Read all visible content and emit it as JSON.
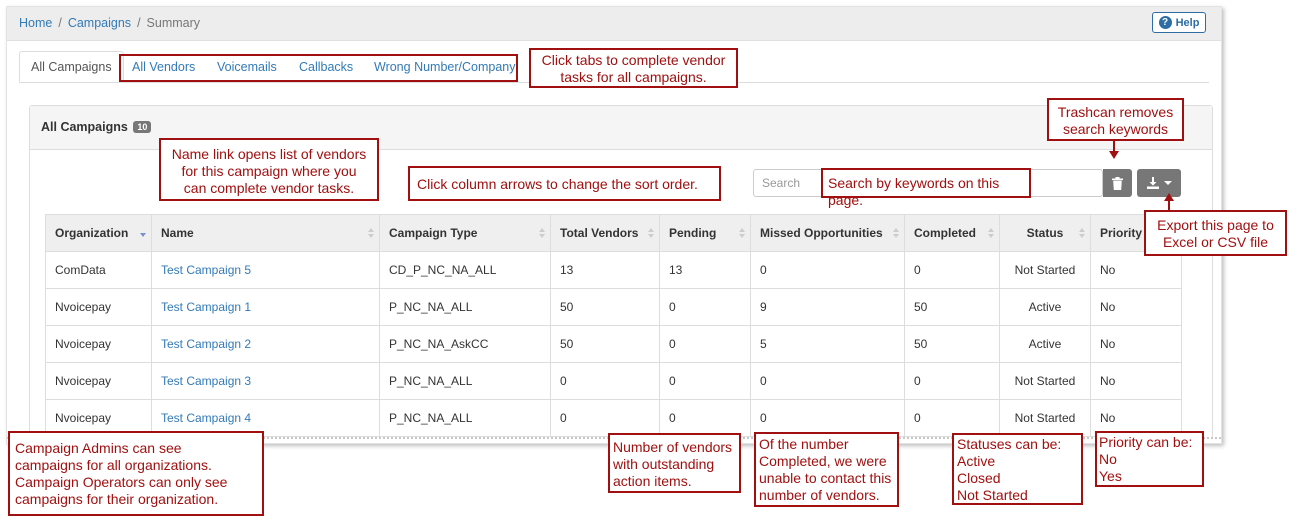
{
  "breadcrumb": {
    "home": "Home",
    "campaigns": "Campaigns",
    "current": "Summary",
    "sep": "/"
  },
  "help": {
    "label": "Help",
    "icon": "question-circle-icon"
  },
  "tabs": [
    {
      "label": "All Campaigns",
      "active": true
    },
    {
      "label": "All Vendors"
    },
    {
      "label": "Voicemails"
    },
    {
      "label": "Callbacks"
    },
    {
      "label": "Wrong Number/Company"
    }
  ],
  "panel": {
    "title": "All Campaigns",
    "count": "10"
  },
  "search": {
    "placeholder": "Search",
    "trash_icon": "trash-icon",
    "export_icon": "download-icon"
  },
  "table": {
    "columns": [
      "Organization",
      "Name",
      "Campaign Type",
      "Total Vendors",
      "Pending",
      "Missed Opportunities",
      "Completed",
      "Status",
      "Priority"
    ],
    "rows": [
      [
        "ComData",
        "Test Campaign 5",
        "CD_P_NC_NA_ALL",
        "13",
        "13",
        "0",
        "0",
        "Not Started",
        "No"
      ],
      [
        "Nvoicepay",
        "Test Campaign 1",
        "P_NC_NA_ALL",
        "50",
        "0",
        "9",
        "50",
        "Active",
        "No"
      ],
      [
        "Nvoicepay",
        "Test Campaign 2",
        "P_NC_NA_AskCC",
        "50",
        "0",
        "5",
        "50",
        "Active",
        "No"
      ],
      [
        "Nvoicepay",
        "Test Campaign 3",
        "P_NC_NA_ALL",
        "0",
        "0",
        "0",
        "0",
        "Not Started",
        "No"
      ],
      [
        "Nvoicepay",
        "Test Campaign 4",
        "P_NC_NA_ALL",
        "0",
        "0",
        "0",
        "0",
        "Not Started",
        "No"
      ]
    ]
  },
  "callouts": {
    "tabs": "Click tabs to complete vendor\ntasks for all campaigns.",
    "trash": "Trashcan removes\nsearch keywords",
    "name_link": "Name link opens list of vendors\nfor this campaign where you\ncan complete vendor tasks.",
    "sort": "Click column arrows to change the sort order.",
    "search": "Search by keywords on this page.",
    "export": "Export this page to\nExcel or CSV file",
    "admins": "Campaign Admins can see\ncampaigns for all organizations.\nCampaign Operators can only see\ncampaigns for their organization.",
    "pending": "Number of vendors\nwith outstanding\naction items.",
    "missed": "Of the number\nCompleted, we were\nunable to contact this\nnumber of vendors.",
    "statuses": "Statuses can be:\n  Active\n  Closed\n  Not Started",
    "priority": "Priority can be:\n  No\n  Yes"
  },
  "colors": {
    "link": "#337ab7",
    "callout": "#a01010",
    "button_gray": "#777777",
    "help_blue": "#2e6da4"
  }
}
